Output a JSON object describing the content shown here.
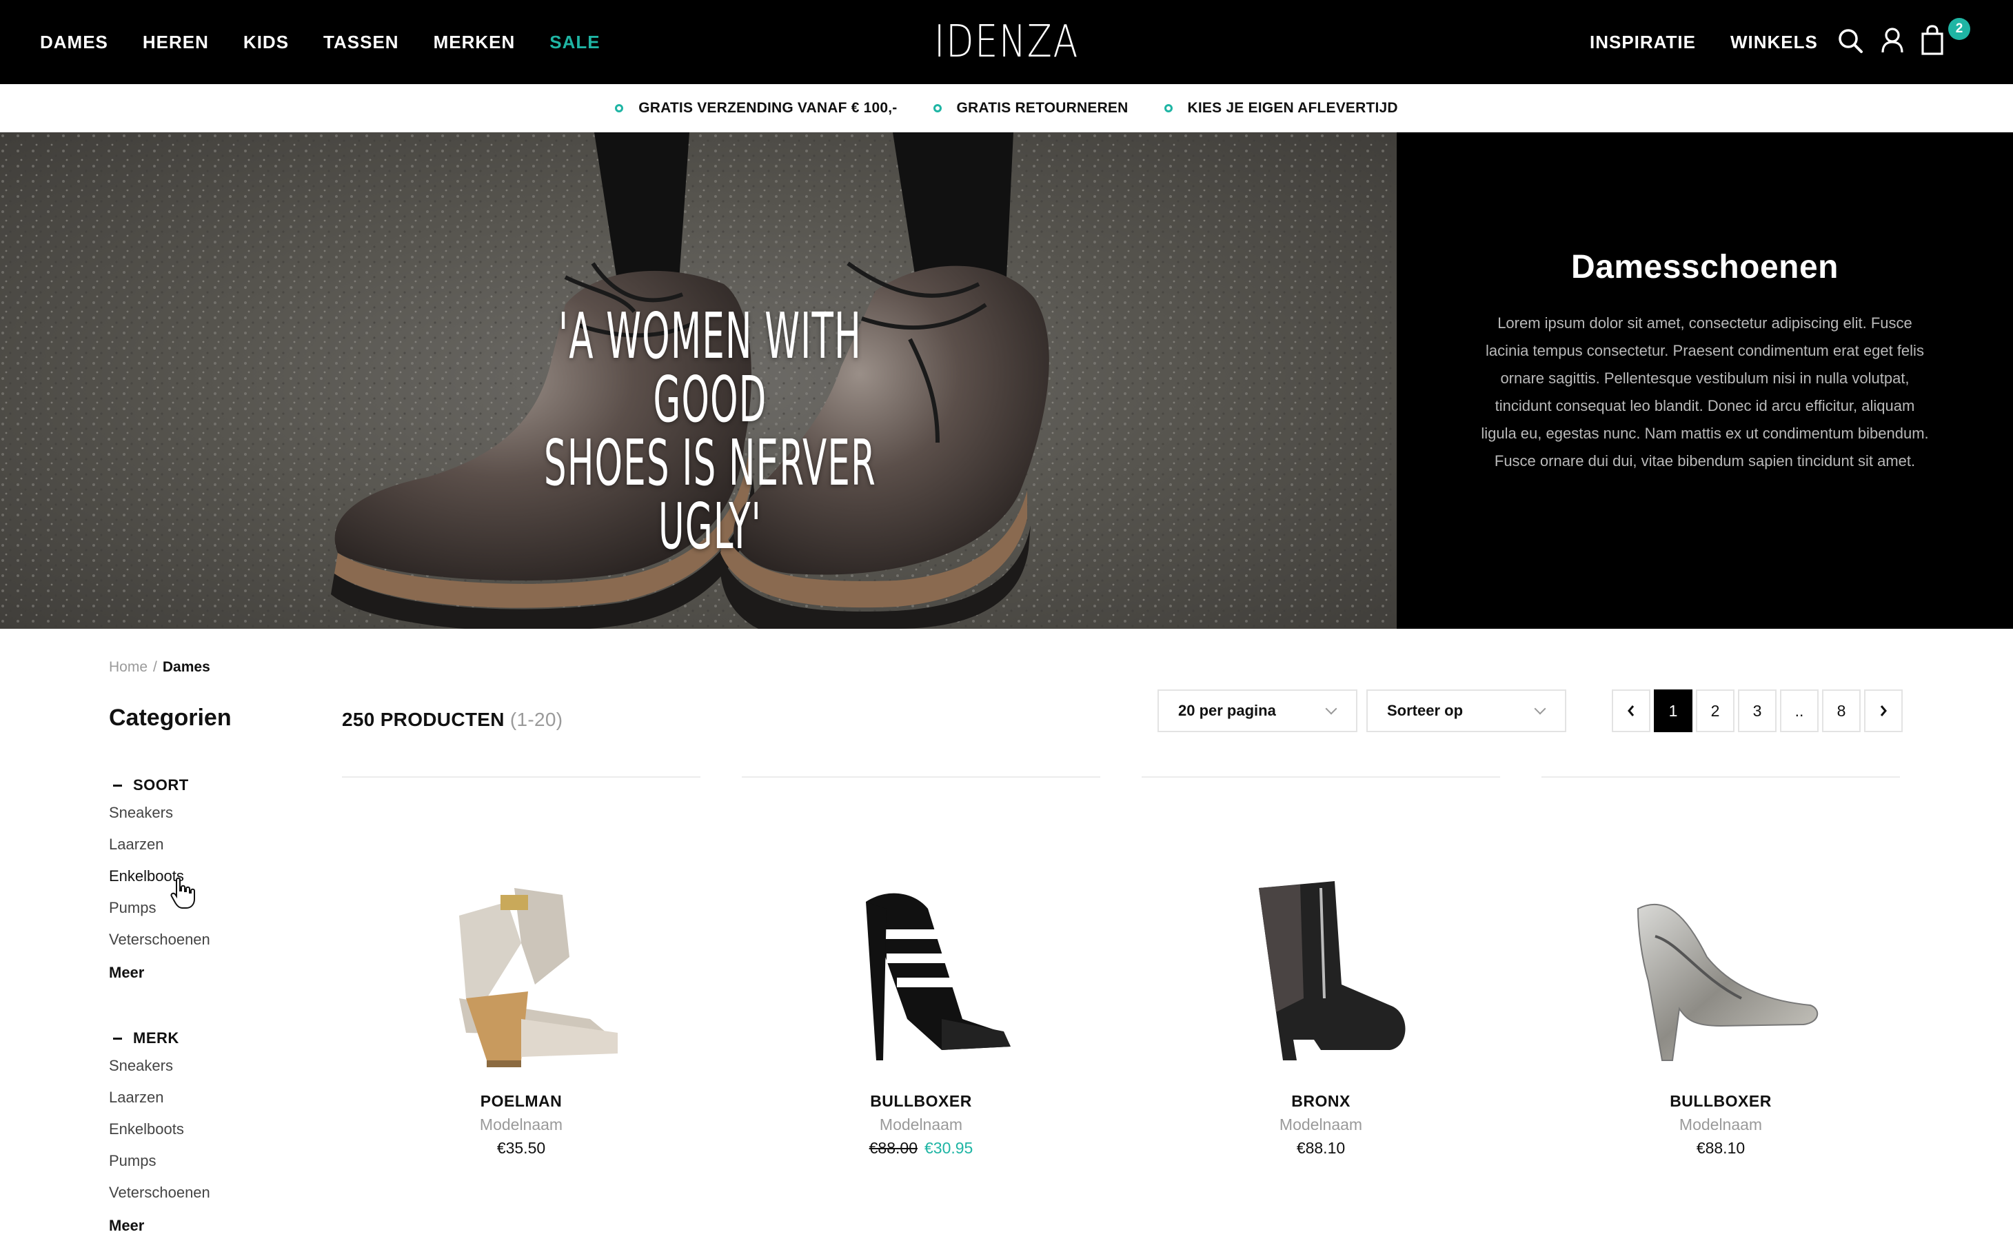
{
  "colors": {
    "accent": "#1fb5a4",
    "nav_bg": "#000000",
    "text": "#111111",
    "muted": "#9a9a9a"
  },
  "nav": {
    "items": [
      "DAMES",
      "HEREN",
      "KIDS",
      "TASSEN",
      "MERKEN",
      "SALE"
    ],
    "logo": "IDENZA",
    "right_items": [
      "INSPIRATIE",
      "WINKELS"
    ],
    "icons": [
      "search-icon",
      "user-icon",
      "bag-icon"
    ],
    "cart_count": "2"
  },
  "usps": [
    "GRATIS VERZENDING VANAF € 100,-",
    "GRATIS RETOURNEREN",
    "KIES JE EIGEN AFLEVERTIJD"
  ],
  "hero": {
    "quote_line1": "'A WOMEN WITH GOOD",
    "quote_line2": "SHOES IS NERVER UGLY'",
    "title": "Damesschoenen",
    "body": "Lorem ipsum dolor sit amet, consectetur adipiscing elit. Fusce lacinia tempus consectetur. Praesent condimentum erat eget felis ornare sagittis. Pellentesque vestibulum nisi in nulla volutpat, tincidunt consequat leo blandit. Donec id arcu efficitur, aliquam ligula eu, egestas nunc. Nam mattis ex ut condimentum bibendum. Fusce ornare dui dui, vitae bibendum sapien tincidunt sit amet."
  },
  "breadcrumb": {
    "home": "Home",
    "separator": "/",
    "current": "Dames"
  },
  "sidebar": {
    "title": "Categorien",
    "facets": [
      {
        "title": "SOORT",
        "items": [
          "Sneakers",
          "Laarzen",
          "Enkelboots",
          "Pumps",
          "Veterschoenen"
        ],
        "more": "Meer"
      },
      {
        "title": "MERK",
        "items": [
          "Sneakers",
          "Laarzen",
          "Enkelboots",
          "Pumps",
          "Veterschoenen"
        ],
        "more": "Meer"
      }
    ]
  },
  "toolbar": {
    "count": "250 PRODUCTEN",
    "range": "(1-20)",
    "per_page": "20 per pagina",
    "sort": "Sorteer op",
    "pages": [
      "1",
      "2",
      "3",
      "..",
      "8"
    ],
    "active_page": "1"
  },
  "products": [
    {
      "brand": "POELMAN",
      "model": "Modelnaam",
      "price": "€35.50",
      "old_price": "",
      "sale_price": ""
    },
    {
      "brand": "BULLBOXER",
      "model": "Modelnaam",
      "price": "",
      "old_price": "€88.00",
      "sale_price": "€30.95"
    },
    {
      "brand": "BRONX",
      "model": "Modelnaam",
      "price": "€88.10",
      "old_price": "",
      "sale_price": ""
    },
    {
      "brand": "BULLBOXER",
      "model": "Modelnaam",
      "price": "€88.10",
      "old_price": "",
      "sale_price": ""
    }
  ]
}
